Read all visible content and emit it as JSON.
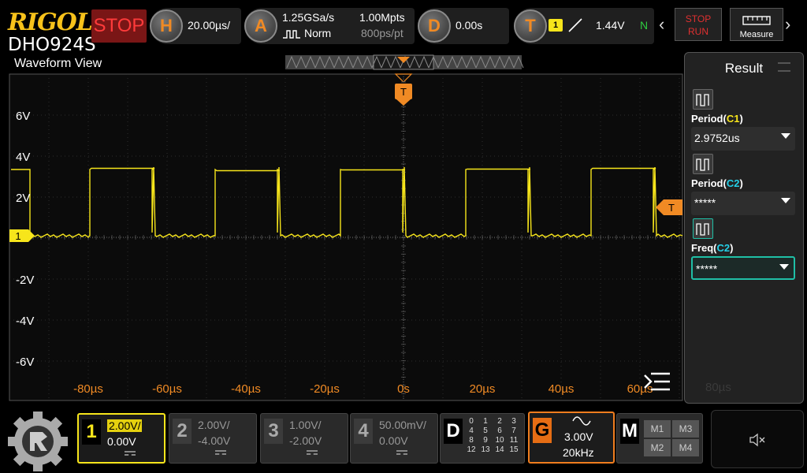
{
  "brand": "RIGOL",
  "model": "DHO924S",
  "status": "STOP",
  "horizontal": {
    "letter": "H",
    "timebase": "20.00µs/"
  },
  "acquire": {
    "letter": "A",
    "sample_rate": "1.25GSa/s",
    "mode": "Norm",
    "memory_depth": "1.00Mpts",
    "resolution": "800ps/pt"
  },
  "delay": {
    "letter": "D",
    "offset": "0.00s"
  },
  "trigger": {
    "letter": "T",
    "source": "1",
    "level": "1.44V",
    "sweep": "N"
  },
  "run_stop": {
    "stop": "STOP",
    "run": "RUN"
  },
  "measure_label": "Measure",
  "waveform_title": "Waveform View",
  "y_labels": [
    "6V",
    "4V",
    "2V",
    "-2V",
    "-4V",
    "-6V"
  ],
  "x_labels": [
    "-80µs",
    "-60µs",
    "-40µs",
    "-20µs",
    "0s",
    "20µs",
    "40µs",
    "60µs",
    "80µs"
  ],
  "channel_marker": "1",
  "trigger_marker": "T",
  "result": {
    "title": "Result",
    "items": [
      {
        "label": "Period",
        "source": "C1",
        "value": "2.9752us"
      },
      {
        "label": "Period",
        "source": "C2",
        "value": "*****"
      },
      {
        "label": "Freq",
        "source": "C2",
        "value": "*****"
      }
    ]
  },
  "channels": [
    {
      "num": "1",
      "scale": "2.00V/",
      "offset": "0.00V"
    },
    {
      "num": "2",
      "scale": "2.00V/",
      "offset": "-4.00V"
    },
    {
      "num": "3",
      "scale": "1.00V/",
      "offset": "-2.00V"
    },
    {
      "num": "4",
      "scale": "50.00mV/",
      "offset": "0.00V"
    }
  ],
  "digital": {
    "letter": "D",
    "rows": [
      [
        "0",
        "1",
        "2",
        "3"
      ],
      [
        "4",
        "5",
        "6",
        "7"
      ],
      [
        "8",
        "9",
        "10",
        "11"
      ],
      [
        "12",
        "13",
        "14",
        "15"
      ]
    ]
  },
  "generator": {
    "letter": "G",
    "amplitude": "3.00V",
    "frequency": "20kHz"
  },
  "math": {
    "letter": "M",
    "items": [
      "M1",
      "M3",
      "M2",
      "M4"
    ]
  },
  "colors": {
    "ch1": "#f7e51b",
    "ch2": "#24d0e8",
    "accent": "#f08a24",
    "grid": "#3d3d3d"
  }
}
